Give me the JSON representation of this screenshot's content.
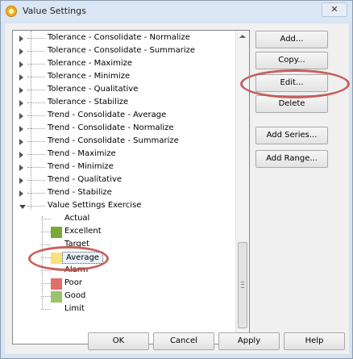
{
  "window": {
    "title": "Value Settings",
    "close_label": "✕"
  },
  "colors": {
    "excellent": "#7aa83b",
    "average": "#f5e27a",
    "poor": "#e06f67",
    "good": "#9bc46b",
    "highlight_circle": "#c0504d"
  },
  "tree": {
    "items": [
      "Tolerance - Consolidate - Normalize",
      "Tolerance - Consolidate - Summarize",
      "Tolerance - Maximize",
      "Tolerance - Minimize",
      "Tolerance - Qualitative",
      "Tolerance - Stabilize",
      "Trend - Consolidate - Average",
      "Trend - Consolidate - Normalize",
      "Trend - Consolidate - Summarize",
      "Trend - Maximize",
      "Trend - Minimize",
      "Trend - Qualitative",
      "Trend - Stabilize"
    ],
    "expanded_item": "Value Settings Exercise",
    "children": [
      {
        "label": "Actual"
      },
      {
        "label": "Excellent"
      },
      {
        "label": "Target"
      },
      {
        "label": "Average"
      },
      {
        "label": "Alarm"
      },
      {
        "label": "Poor"
      },
      {
        "label": "Good"
      },
      {
        "label": "Limit"
      }
    ]
  },
  "side_buttons": {
    "add": "Add...",
    "copy": "Copy...",
    "edit": "Edit...",
    "delete": "Delete",
    "add_series": "Add Series...",
    "add_range": "Add Range..."
  },
  "bottom_buttons": {
    "ok": "OK",
    "cancel": "Cancel",
    "apply": "Apply",
    "help": "Help"
  }
}
